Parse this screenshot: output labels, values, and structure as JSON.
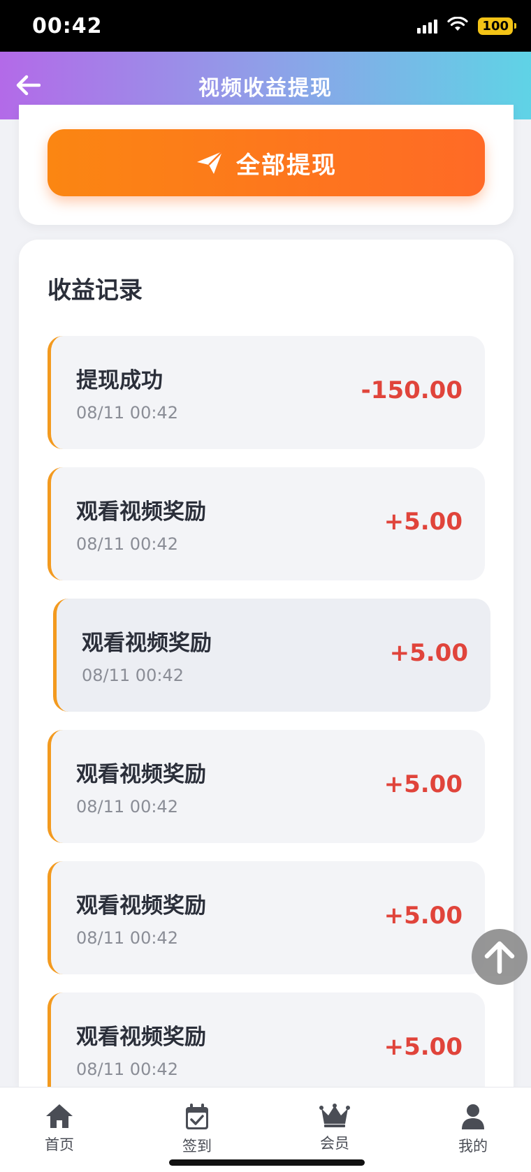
{
  "status_bar": {
    "time": "00:42",
    "battery": "100"
  },
  "header": {
    "title": "视频收益提现"
  },
  "withdraw": {
    "label": "全部提现"
  },
  "records": {
    "title": "收益记录",
    "items": [
      {
        "title": "提现成功",
        "time": "08/11 00:42",
        "amount": "-150.00"
      },
      {
        "title": "观看视频奖励",
        "time": "08/11 00:42",
        "amount": "+5.00"
      },
      {
        "title": "观看视频奖励",
        "time": "08/11 00:42",
        "amount": "+5.00"
      },
      {
        "title": "观看视频奖励",
        "time": "08/11 00:42",
        "amount": "+5.00"
      },
      {
        "title": "观看视频奖励",
        "time": "08/11 00:42",
        "amount": "+5.00"
      },
      {
        "title": "观看视频奖励",
        "time": "08/11 00:42",
        "amount": "+5.00"
      }
    ]
  },
  "nav": {
    "items": [
      {
        "label": "首页",
        "icon": "home-icon"
      },
      {
        "label": "签到",
        "icon": "calendar-check-icon"
      },
      {
        "label": "会员",
        "icon": "crown-icon"
      },
      {
        "label": "我的",
        "icon": "user-icon"
      }
    ]
  },
  "colors": {
    "accent_orange": "#fb8612",
    "amount_red": "#e0443b",
    "header_gradient_start": "#b36ae8",
    "header_gradient_end": "#5fd3e6"
  }
}
